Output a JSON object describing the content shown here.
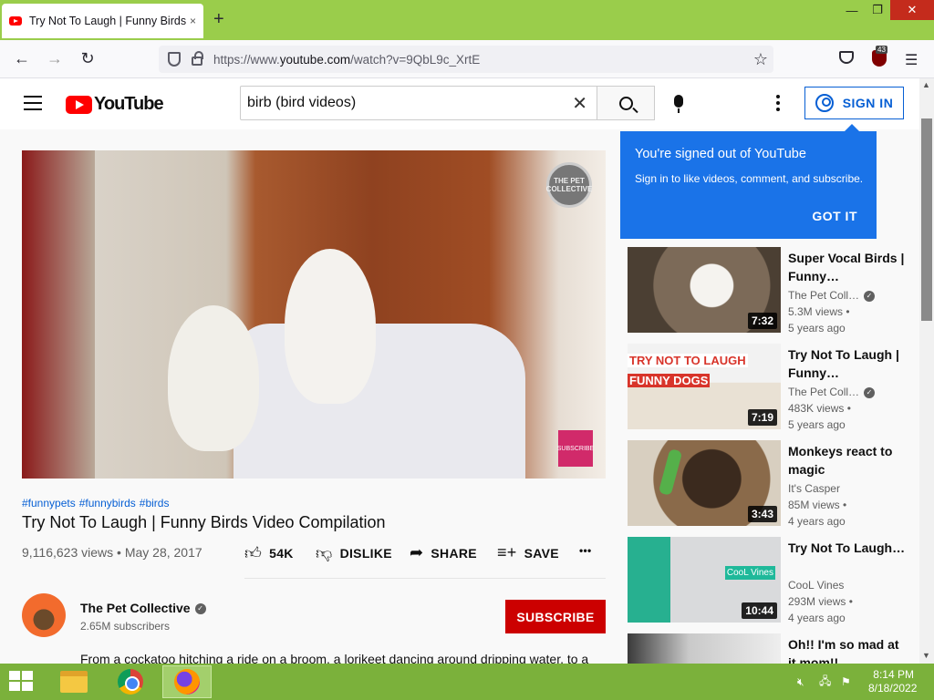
{
  "browser": {
    "tab_title": "Try Not To Laugh | Funny Birds",
    "tab_close": "×",
    "new_tab": "+",
    "win_minimize": "—",
    "win_restore": "❐",
    "win_close": "✕",
    "url_prefix": "https://www.",
    "url_domain": "youtube.com",
    "url_suffix": "/watch?v=9QbL9c_XrtE",
    "back": "←",
    "forward": "→",
    "reload": "↻",
    "bookmark_star": "☆",
    "ublock_count": "43",
    "menu": "☰"
  },
  "youtube": {
    "logo_text": "YouTube",
    "search_query": "birb (bird videos)",
    "clear": "✕",
    "signin_label": "SIGN IN"
  },
  "popup": {
    "title": "You're signed out of YouTube",
    "body": "Sign in to like videos, comment, and subscribe.",
    "button": "GOT IT"
  },
  "video": {
    "watermark": "THE PET COLLECTIVE",
    "subscribe_badge": "SUBSCRIBE",
    "hashtags": [
      "#funnypets",
      "#funnybirds",
      "#birds"
    ],
    "title": "Try Not To Laugh | Funny Birds Video Compilation",
    "meta": "9,116,623 views • May 28, 2017",
    "likes": "54K",
    "dislike": "DISLIKE",
    "share": "SHARE",
    "save": "SAVE",
    "more": "•••"
  },
  "channel": {
    "name": "The Pet Collective",
    "subscribers": "2.65M subscribers",
    "subscribe_label": "SUBSCRIBE",
    "description": "From a cockatoo hitching a ride on a broom, a lorikeet dancing around dripping water, to a"
  },
  "recommendations": [
    {
      "title": "Super Vocal Birds | Funny…",
      "channel": "The Pet Coll…",
      "verified": true,
      "views": "5.3M views •",
      "age": "5 years ago",
      "duration": "7:32"
    },
    {
      "title": "Try Not To Laugh | Funny…",
      "channel": "The Pet Coll…",
      "verified": true,
      "views": "483K views •",
      "age": "5 years ago",
      "duration": "7:19",
      "thumb_line1": "TRY NOT TO LAUGH",
      "thumb_line2": "FUNNY DOGS"
    },
    {
      "title": "Monkeys react to magic",
      "channel": "It's Casper",
      "verified": false,
      "views": "85M views •",
      "age": "4 years ago",
      "duration": "3:43"
    },
    {
      "title": "Try Not To Laugh…",
      "channel": "CooL Vines",
      "verified": false,
      "views": "293M views •",
      "age": "4 years ago",
      "duration": "10:44",
      "thumb_badge": "CooL Vines"
    },
    {
      "title": "Oh!! I'm so mad at it mom!!",
      "channel": "",
      "verified": false,
      "views": "",
      "age": "",
      "duration": ""
    }
  ],
  "taskbar": {
    "time": "8:14 PM",
    "date": "8/18/2022"
  }
}
